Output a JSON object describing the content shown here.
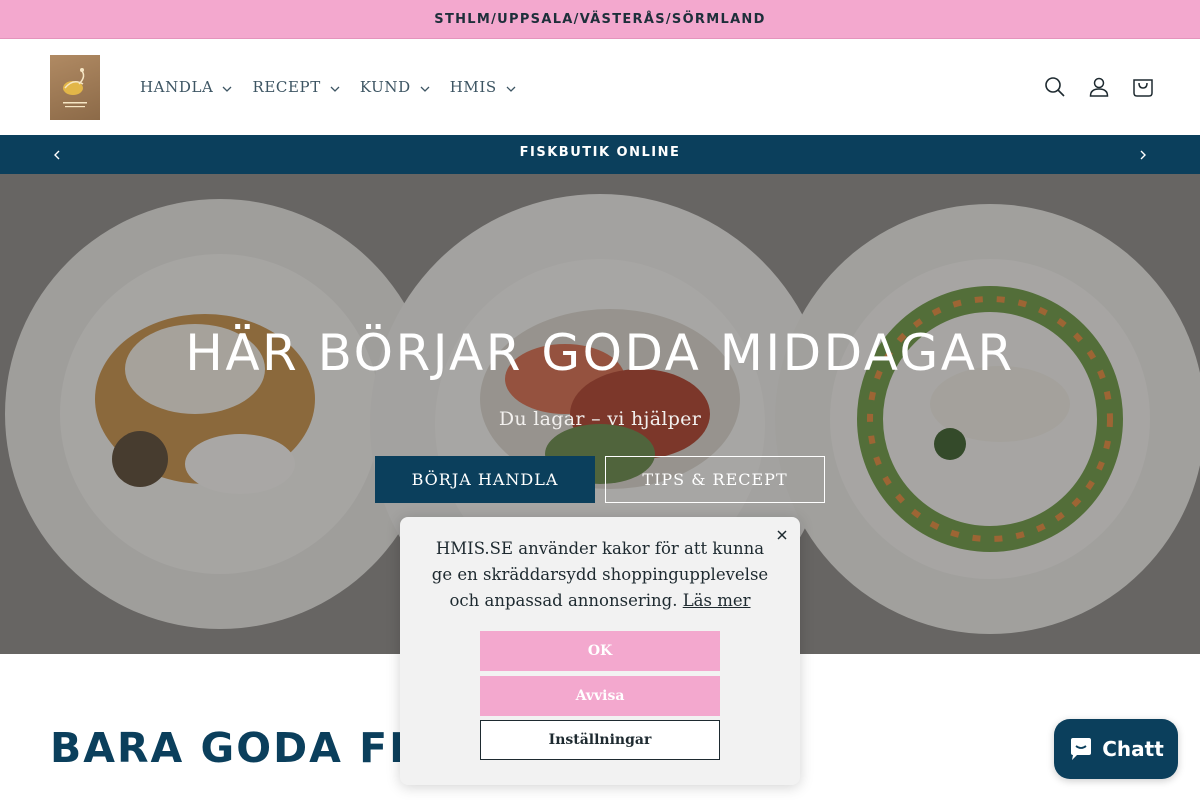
{
  "topbar": {
    "text": "STHLM/UPPSALA/VÄSTERÅS/SÖRMLAND"
  },
  "header": {
    "nav": [
      {
        "label": "HANDLA"
      },
      {
        "label": "RECEPT"
      },
      {
        "label": "KUND"
      },
      {
        "label": "HMIS"
      }
    ],
    "icons": [
      "search-icon",
      "account-icon",
      "cart-icon"
    ]
  },
  "announcement": {
    "text": "FISKBUTIK ONLINE"
  },
  "hero": {
    "title": "HÄR BÖRJAR GODA MIDDAGAR",
    "subtitle": "Du lagar – vi hjälper",
    "primary_button": "BÖRJA HANDLA",
    "secondary_button": "TIPS & RECEPT"
  },
  "section": {
    "title": "BARA GODA FISKAR"
  },
  "cookie": {
    "text": "HMIS.SE använder kakor för att kunna ge en skräddarsydd shoppingupplevelse och anpassad annonsering.",
    "link": "Läs mer",
    "ok": "OK",
    "deny": "Avvisa",
    "settings": "Inställningar"
  },
  "chat": {
    "label": "Chatt"
  },
  "colors": {
    "brand_navy": "#0b3f5c",
    "brand_pink": "#f3a8ce",
    "logo_brown": "#9c7a55"
  }
}
